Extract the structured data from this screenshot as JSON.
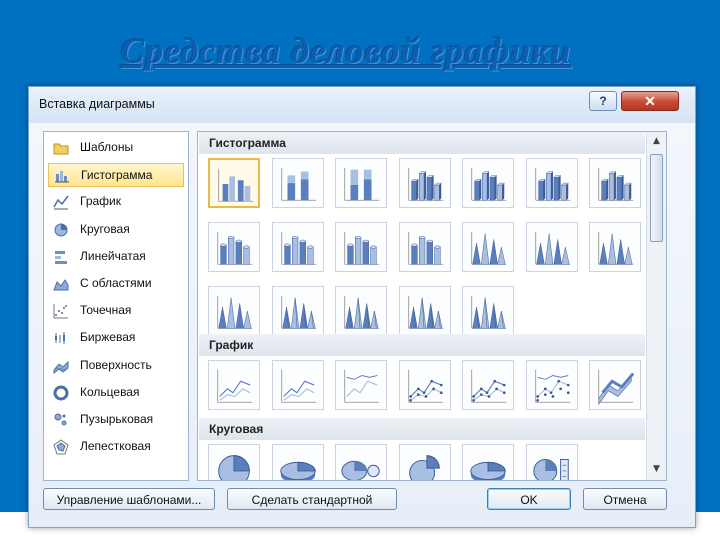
{
  "slide": {
    "title": "Средства деловой графики"
  },
  "dialog": {
    "title": "Вставка диаграммы",
    "help_label": "?",
    "close_label": "✕",
    "categories": [
      {
        "label": "Шаблоны",
        "icon": "folder-icon",
        "selected": false
      },
      {
        "label": "Гистограмма",
        "icon": "column-chart-icon",
        "selected": true
      },
      {
        "label": "График",
        "icon": "line-chart-icon",
        "selected": false
      },
      {
        "label": "Круговая",
        "icon": "pie-chart-icon",
        "selected": false
      },
      {
        "label": "Линейчатая",
        "icon": "bar-chart-icon",
        "selected": false
      },
      {
        "label": "С областями",
        "icon": "area-chart-icon",
        "selected": false
      },
      {
        "label": "Точечная",
        "icon": "scatter-chart-icon",
        "selected": false
      },
      {
        "label": "Биржевая",
        "icon": "stock-chart-icon",
        "selected": false
      },
      {
        "label": "Поверхность",
        "icon": "surface-chart-icon",
        "selected": false
      },
      {
        "label": "Кольцевая",
        "icon": "doughnut-chart-icon",
        "selected": false
      },
      {
        "label": "Пузырьковая",
        "icon": "bubble-chart-icon",
        "selected": false
      },
      {
        "label": "Лепестковая",
        "icon": "radar-chart-icon",
        "selected": false
      }
    ],
    "sections": [
      {
        "header": "Гистограмма",
        "thumbs": [
          "clustered-column-icon",
          "stacked-column-icon",
          "percent-stacked-column-icon",
          "3d-clustered-column-icon",
          "3d-stacked-column-icon",
          "3d-percent-stacked-column-icon",
          "3d-column-icon",
          "clustered-cylinder-icon",
          "stacked-cylinder-icon",
          "percent-stacked-cylinder-icon",
          "3d-cylinder-icon",
          "clustered-cone-icon",
          "stacked-cone-icon",
          "percent-stacked-cone-icon",
          "3d-cone-icon",
          "clustered-pyramid-icon",
          "stacked-pyramid-icon",
          "percent-stacked-pyramid-icon",
          "3d-pyramid-icon"
        ]
      },
      {
        "header": "График",
        "thumbs": [
          "line-icon",
          "stacked-line-icon",
          "percent-stacked-line-icon",
          "line-with-markers-icon",
          "stacked-line-with-markers-icon",
          "percent-line-with-markers-icon",
          "3d-line-icon"
        ]
      },
      {
        "header": "Круговая",
        "thumbs": [
          "pie-icon",
          "3d-pie-icon",
          "pie-of-pie-icon",
          "exploded-pie-icon",
          "3d-exploded-pie-icon",
          "bar-of-pie-icon"
        ]
      }
    ],
    "buttons": {
      "manage_templates": "Управление шаблонами...",
      "set_default": "Сделать стандартной",
      "ok": "OK",
      "cancel": "Отмена"
    },
    "colors": {
      "accent": "#0070C0",
      "selection": "#FFE68C",
      "close": "#C84A35"
    }
  }
}
